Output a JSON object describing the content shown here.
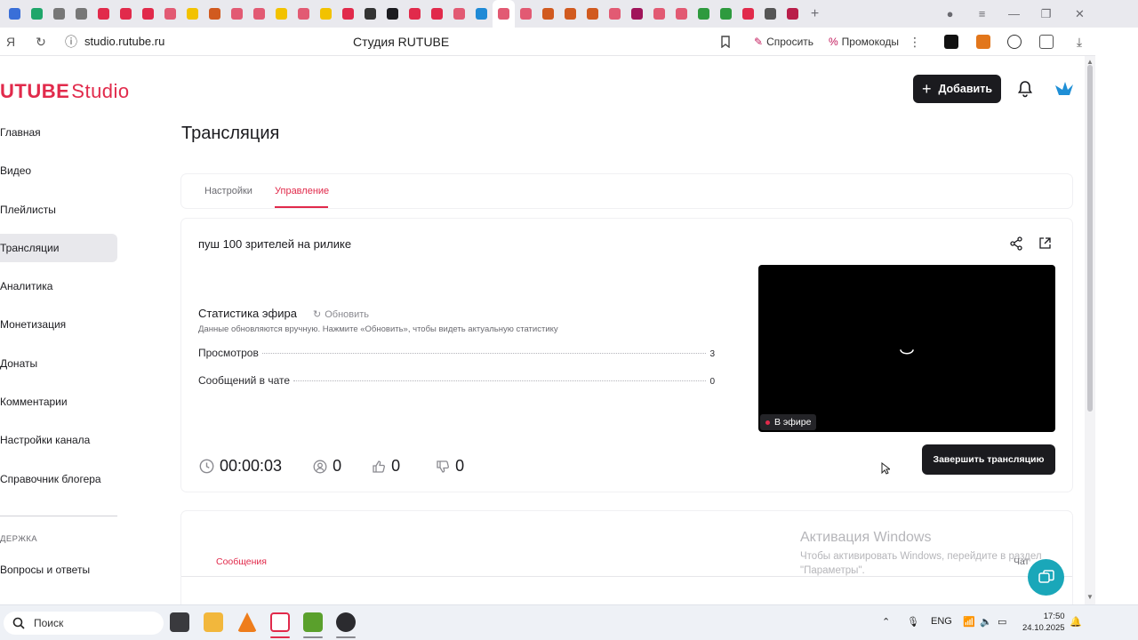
{
  "browser": {
    "url": "studio.rutube.ru",
    "page_title": "Студия RUTUBE",
    "ask_label": "Спросить",
    "promo_label": "Промокоды",
    "tab_colors": [
      "#3a6fd8",
      "#1fa66a",
      "#777777",
      "#777777",
      "#e12a4b",
      "#e12a4b",
      "#e12a4b",
      "#e25a73",
      "#f2c200",
      "#d15a1f",
      "#e25a73",
      "#e25a73",
      "#f2c200",
      "#e25a73",
      "#f2c200",
      "#e12a4b",
      "#333333",
      "#1b1b1f",
      "#e12a4b",
      "#e12a4b",
      "#e25a73",
      "#1f8ad6",
      "#e25a73",
      "#e25a73",
      "#d15a1f",
      "#d15a1f",
      "#d15a1f",
      "#e25a73",
      "#a0145a",
      "#e25a73",
      "#e25a73",
      "#2e9a3e",
      "#2e9a3e",
      "#e12a4b",
      "#555555",
      "#b91e4a"
    ]
  },
  "header": {
    "logo_main": "UTUBE",
    "logo_studio": "Studio",
    "add_button": "Добавить"
  },
  "sidebar": {
    "items": [
      {
        "label": "Главная"
      },
      {
        "label": "Видео"
      },
      {
        "label": "Плейлисты"
      },
      {
        "label": "Трансляции"
      },
      {
        "label": "Аналитика"
      },
      {
        "label": "Монетизация"
      },
      {
        "label": "Донаты"
      },
      {
        "label": "Комментарии"
      },
      {
        "label": "Настройки канала"
      },
      {
        "label": "Справочник блогера"
      }
    ],
    "active_index": 3,
    "section_label": "ДЕРЖКА",
    "faq_label": "Вопросы и ответы"
  },
  "main": {
    "title": "Трансляция",
    "tabs": [
      {
        "label": "Настройки"
      },
      {
        "label": "Управление"
      }
    ],
    "stream_name": "пуш 100 зрителей на рилике",
    "stats_title": "Статистика эфира",
    "refresh_label": "Обновить",
    "stats_note": "Данные обновляются вручную. Нажмите «Обновить», чтобы видеть актуальную статистику",
    "stats": [
      {
        "label": "Просмотров",
        "value": "3"
      },
      {
        "label": "Сообщений в чате",
        "value": "0"
      }
    ],
    "duration": "00:00:03",
    "viewers": "0",
    "likes": "0",
    "dislikes": "0",
    "live_badge": "В эфире",
    "end_button": "Завершить трансляцию"
  },
  "chat": {
    "tab_label": "Сообщения",
    "chat_label": "Чат"
  },
  "watermark": {
    "title": "Активация Windows",
    "line1": "Чтобы активировать Windows, перейдите в раздел",
    "line2": "\"Параметры\"."
  },
  "taskbar": {
    "search_placeholder": "Поиск",
    "lang": "ENG",
    "time": "17:50",
    "date": "24.10.2025"
  },
  "colors": {
    "accent": "#e12a4b",
    "dark": "#1b1b1f",
    "help": "#1aa7b9"
  }
}
